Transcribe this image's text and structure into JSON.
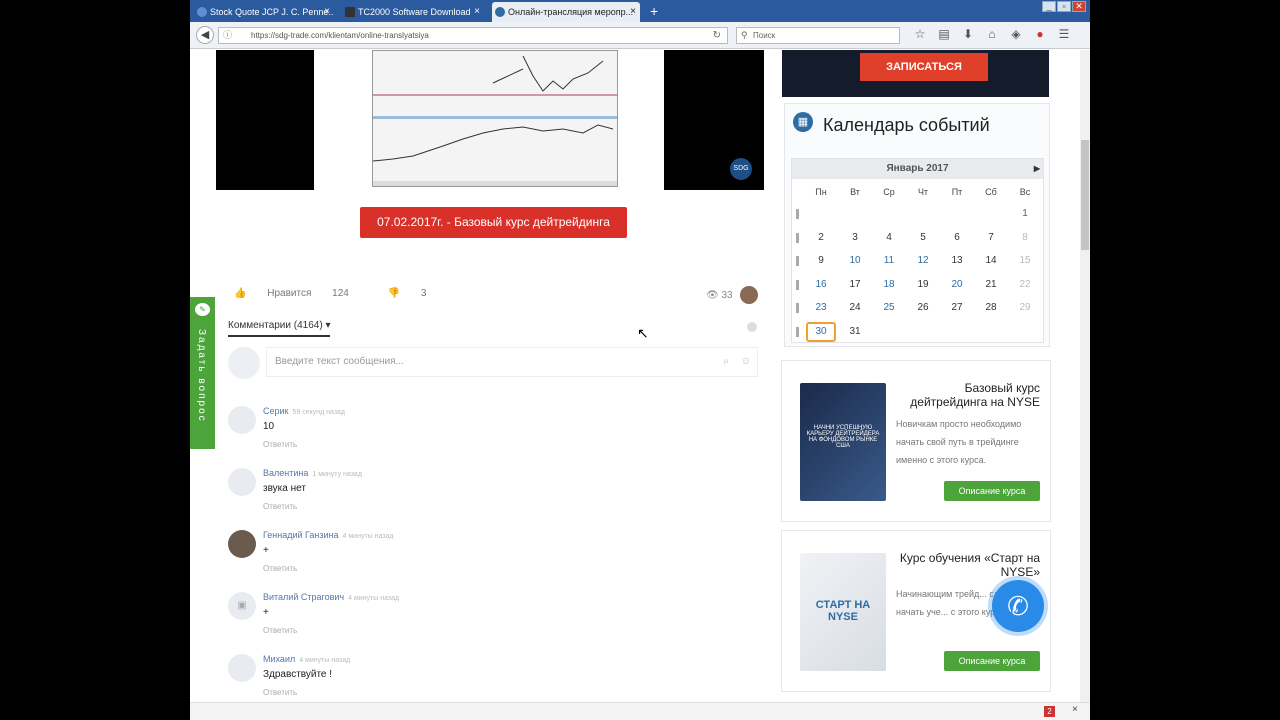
{
  "browser": {
    "tabs": [
      {
        "label": "Stock Quote JCP J. C. Penne...",
        "active": false
      },
      {
        "label": "TC2000 Software Download",
        "active": false
      },
      {
        "label": "Онлайн-трансляция меропр...",
        "active": true
      }
    ],
    "new_tab": "+",
    "url": "https://sdg-trade.com/klientam/online-translyatsiya",
    "search_placeholder": "Поиск"
  },
  "video": {
    "logo": "SDG"
  },
  "course_button": "07.02.2017г. - Базовый курс дейтрейдинга",
  "reactions": {
    "likes_label": "Нравится",
    "likes_count": "124",
    "dislikes": "3",
    "views": "33"
  },
  "comments": {
    "tab_label": "Комментарии (4164)",
    "input_placeholder": "Введите текст сообщения...",
    "reply_label": "Ответить",
    "items": [
      {
        "name": "Серик",
        "time": "59 секунд назад",
        "text": "10"
      },
      {
        "name": "Валентина",
        "time": "1 минуту назад",
        "text": "звука нет"
      },
      {
        "name": "Геннадий Ганзина",
        "time": "4 минуты назад",
        "text": "+"
      },
      {
        "name": "Виталий Страгович",
        "time": "4 минуты назад",
        "text": "+"
      },
      {
        "name": "Михаил",
        "time": "4 минуты назад",
        "text": "Здравствуйте !"
      }
    ]
  },
  "ask_tab": "Задать вопрос",
  "signup_button": "ЗАПИСАТЬСЯ",
  "calendar": {
    "title": "Календарь событий",
    "month": "Январь 2017",
    "weekdays": [
      "Пн",
      "Вт",
      "Ср",
      "Чт",
      "Пт",
      "Сб",
      "Вс"
    ],
    "today": "30",
    "rows": [
      [
        "",
        "",
        "",
        "",
        "",
        "",
        "1"
      ],
      [
        "2",
        "3",
        "4",
        "5",
        "6",
        "7",
        "8"
      ],
      [
        "9",
        "10",
        "11",
        "12",
        "13",
        "14",
        "15"
      ],
      [
        "16",
        "17",
        "18",
        "19",
        "20",
        "21",
        "22"
      ],
      [
        "23",
        "24",
        "25",
        "26",
        "27",
        "28",
        "29"
      ],
      [
        "30",
        "31",
        "",
        "",
        "",
        "",
        ""
      ]
    ],
    "event_days": [
      "1",
      "10",
      "11",
      "12",
      "16",
      "18",
      "20",
      "23",
      "25",
      "30"
    ]
  },
  "promos": [
    {
      "title": "Базовый курс дейтрейдинга на NYSE",
      "desc": "Новичкам просто необходимо начать свой путь в трейдинге именно с этого курса.",
      "button": "Описание курса",
      "box_label": "НАЧНИ УСПЕШНУЮ КАРЬЕРУ ДЕЙТРЕЙДЕРА НА ФОНДОВОМ РЫНКЕ США"
    },
    {
      "title": "Курс обучения «Старт на NYSE»",
      "desc": "Начинающим трейд... следует начать уче... с этого курса.",
      "button": "Описание курса",
      "box_label": "СТАРТ НА NYSE"
    }
  ],
  "status": {
    "badge": "2",
    "close": "×"
  },
  "colors": {
    "accent_red": "#d9302a",
    "green": "#4ca43b",
    "blue": "#2e6da4",
    "call_blue": "#2a8ae8"
  }
}
